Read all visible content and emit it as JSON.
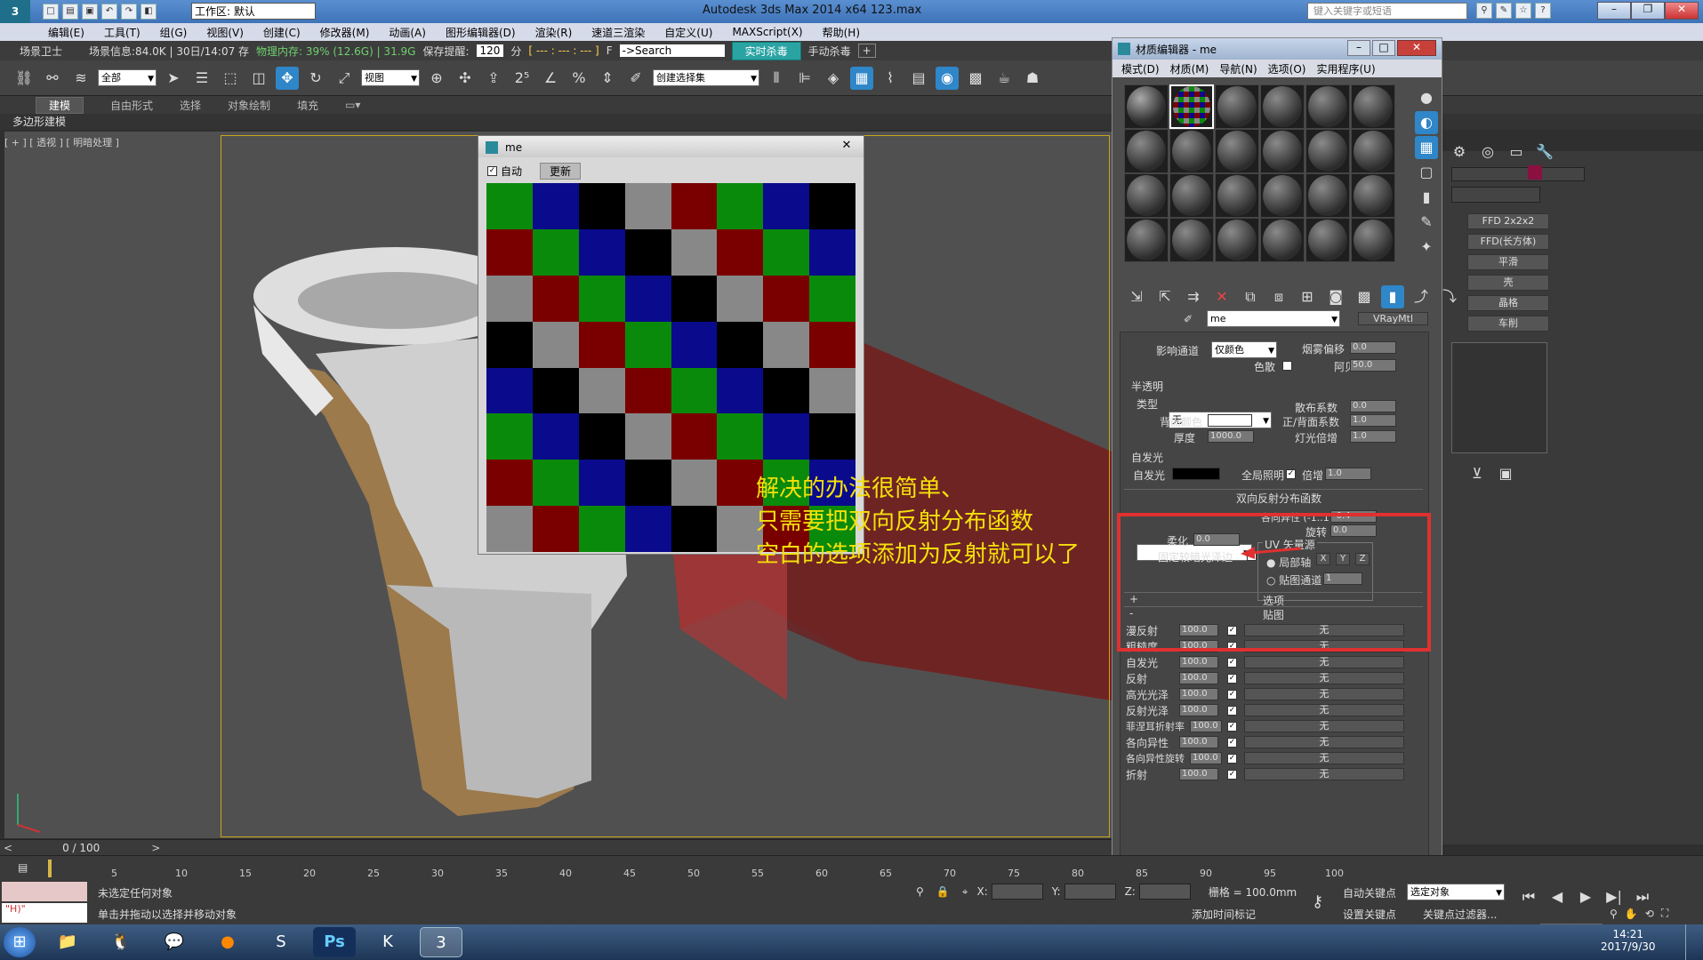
{
  "titlebar": {
    "app_title": "Autodesk 3ds Max  2014 x64      123.max",
    "workspace": "工作区: 默认",
    "search_placeholder": "键入关键字或短语"
  },
  "menubar": [
    "编辑(E)",
    "工具(T)",
    "组(G)",
    "视图(V)",
    "创建(C)",
    "修改器(M)",
    "动画(A)",
    "图形编辑器(D)",
    "渲染(R)",
    "速道三渲染",
    "自定义(U)",
    "MAXScript(X)",
    "帮助(H)"
  ],
  "statusline": {
    "guard": "场景卫士",
    "scene_info": "场景信息:84.0K | 30日/14:07 存",
    "mem": "物理内存: 39% (12.6G) | 31.9G",
    "save_reminder": "保存提醒:",
    "save_value": "120",
    "minutes": "分",
    "dashes": "[ --- : --- : --- ]",
    "f": "F",
    "search": "->Search",
    "realtime_kill": "实时杀毒",
    "manual_kill": "手动杀毒"
  },
  "toolbar": {
    "filter": "全部",
    "coord": "视图",
    "selset": "创建选择集"
  },
  "ribbon": {
    "tabs": [
      "建模",
      "自由形式",
      "选择",
      "对象绘制",
      "填充"
    ],
    "sub": "多边形建模"
  },
  "viewport": {
    "label": "[ + ] [ 透视 ] [ 明暗处理 ]"
  },
  "timeline": {
    "frame": "0 / 100"
  },
  "ruler": [
    "5",
    "10",
    "15",
    "20",
    "25",
    "30",
    "35",
    "40",
    "45",
    "50",
    "55",
    "60",
    "65",
    "70",
    "75",
    "80",
    "85",
    "90",
    "95",
    "100"
  ],
  "status": {
    "msg1": "未选定任何对象",
    "msg2": "单击并拖动以选择并移动对象",
    "x": "X:",
    "y": "Y:",
    "z": "Z:",
    "grid": "栅格 = 100.0mm",
    "add_time_tag": "添加时间标记",
    "autokey": "自动关键点",
    "selected_obj": "选定对象",
    "setkey": "设置关键点",
    "key_filter": "关键点过滤器...",
    "frame_val": "0",
    "script_line": "\"H)\""
  },
  "clock": {
    "time": "14:21",
    "date": "2017/9/30"
  },
  "me_window": {
    "title": "me",
    "auto": "自动",
    "update": "更新"
  },
  "me_grid_colors": [
    "#0a8a0a",
    "#0a0a8c",
    "#000000",
    "#888888",
    "#7a0000",
    "#0a8a0a",
    "#0a0a8c",
    "#000000",
    "#7a0000",
    "#0a8a0a",
    "#0a0a8c",
    "#000000",
    "#888888",
    "#7a0000",
    "#0a8a0a",
    "#0a0a8c",
    "#888888",
    "#7a0000",
    "#0a8a0a",
    "#0a0a8c",
    "#000000",
    "#888888",
    "#7a0000",
    "#0a8a0a",
    "#000000",
    "#888888",
    "#7a0000",
    "#0a8a0a",
    "#0a0a8c",
    "#000000",
    "#888888",
    "#7a0000",
    "#0a0a8c",
    "#000000",
    "#888888",
    "#7a0000",
    "#0a8a0a",
    "#0a0a8c",
    "#000000",
    "#888888",
    "#0a8a0a",
    "#0a0a8c",
    "#000000",
    "#888888",
    "#7a0000",
    "#0a8a0a",
    "#0a0a8c",
    "#000000",
    "#7a0000",
    "#0a8a0a",
    "#0a0a8c",
    "#000000",
    "#888888",
    "#7a0000",
    "#0a8a0a",
    "#0a0a8c",
    "#888888",
    "#7a0000",
    "#0a8a0a",
    "#0a0a8c",
    "#000000",
    "#888888",
    "#7a0000",
    "#0a8a0a"
  ],
  "mated": {
    "title": "材质编辑器 - me",
    "menu": [
      "模式(D)",
      "材质(M)",
      "导航(N)",
      "选项(O)",
      "实用程序(U)"
    ],
    "mat_name": "me",
    "mat_type": "VRayMtl",
    "fog": {
      "affect_channel": "影响通道",
      "channel_val": "仅颜色",
      "fog_bias": "烟雾偏移",
      "fog_bias_val": "0.0",
      "dispersion": "色散",
      "abbe": "阿贝",
      "abbe_val": "50.0"
    },
    "translucency": {
      "title": "半透明",
      "type": "类型",
      "type_val": "无",
      "scatter": "散布系数",
      "scatter_val": "0.0",
      "back_color": "背面颜色",
      "fb": "正/背面系数",
      "fb_val": "1.0",
      "thickness": "厚度",
      "thickness_val": "1000.0",
      "light_mult": "灯光倍增",
      "light_mult_val": "1.0"
    },
    "selfillum": {
      "title": "自发光",
      "label": "自发光",
      "gi": "全局照明",
      "mult": "倍增",
      "mult_val": "1.0"
    },
    "brdf": {
      "title": "双向反射分布函数",
      "anisotropy": "各向异性 (-1..1)",
      "aniso_val": "-0.4",
      "rotation": "旋转",
      "rot_val": "0.0",
      "soften": "柔化",
      "soften_val": "0.0",
      "fix_dark": "固定较暗光泽边",
      "uv_src": "UV 矢量源",
      "local_axis": "局部轴",
      "x": "X",
      "y": "Y",
      "z": "Z",
      "map_channel": "贴图通道",
      "channel_val": "1"
    },
    "options": "选项",
    "maps_title": "贴图",
    "maps": [
      {
        "name": "漫反射",
        "val": "100.0",
        "map": "无"
      },
      {
        "name": "粗糙度",
        "val": "100.0",
        "map": "无"
      },
      {
        "name": "自发光",
        "val": "100.0",
        "map": "无"
      },
      {
        "name": "反射",
        "val": "100.0",
        "map": "无"
      },
      {
        "name": "高光光泽",
        "val": "100.0",
        "map": "无"
      },
      {
        "name": "反射光泽",
        "val": "100.0",
        "map": "无"
      },
      {
        "name": "菲涅耳折射率",
        "val": "100.0",
        "map": "无"
      },
      {
        "name": "各向异性",
        "val": "100.0",
        "map": "无"
      },
      {
        "name": "各向异性旋转",
        "val": "100.0",
        "map": "无"
      },
      {
        "name": "折射",
        "val": "100.0",
        "map": "无"
      }
    ]
  },
  "cmdpanel": {
    "mods": [
      "FFD 2x2x2",
      "FFD(长方体)",
      "平滑",
      "壳",
      "晶格",
      "车削"
    ]
  },
  "annotation": [
    "解决的办法很简单、",
    "只需要把双向反射分布函数",
    "空白的选项添加为反射就可以了"
  ],
  "colors": {
    "accent_red": "#e03030",
    "annotation_yellow": "#f5e10a",
    "teal": "#2aa3a3"
  }
}
